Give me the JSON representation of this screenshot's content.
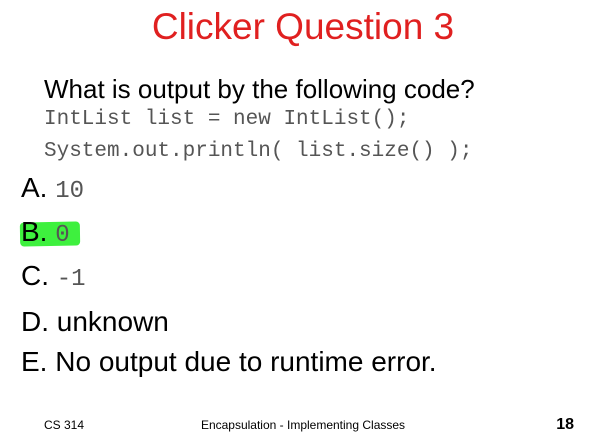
{
  "slide": {
    "title": "Clicker Question 3",
    "question": "What is output by the following code?",
    "code_lines": [
      "IntList list = new IntList();",
      "System.out.println( list.size() );"
    ],
    "choices": [
      {
        "letter": "A.",
        "text": "10",
        "monospace": true
      },
      {
        "letter": "B.",
        "text": "0",
        "monospace": true,
        "highlighted": true
      },
      {
        "letter": "C.",
        "text": "-1",
        "monospace": true
      },
      {
        "letter": "D.",
        "text": "unknown",
        "monospace": false
      },
      {
        "letter": "E.",
        "text": "No output due to runtime error.",
        "monospace": false
      }
    ],
    "highlight_color": "#3ef03e",
    "title_color": "#e02020"
  },
  "footer": {
    "course": "CS 314",
    "topic": "Encapsulation - Implementing Classes",
    "page_number": "18"
  }
}
